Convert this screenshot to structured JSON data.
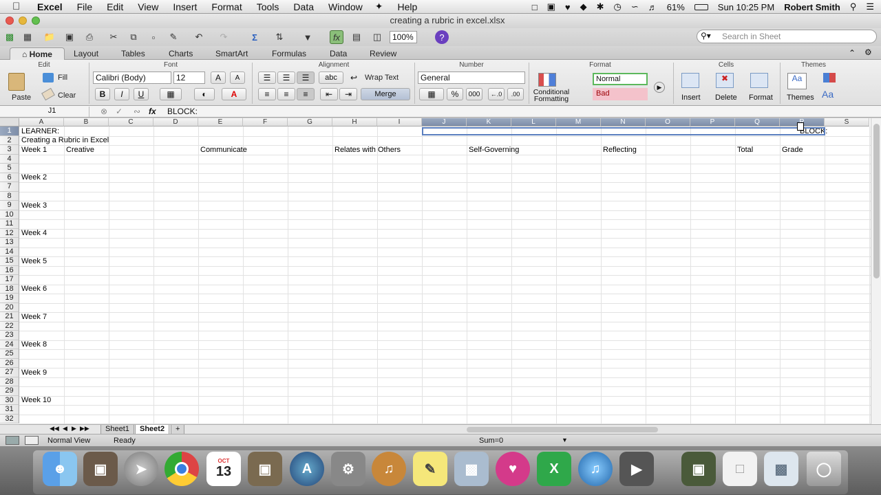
{
  "menubar": {
    "app": "Excel",
    "items": [
      "File",
      "Edit",
      "View",
      "Insert",
      "Format",
      "Tools",
      "Data",
      "Window",
      "Help"
    ],
    "battery": "61%",
    "clock": "Sun 10:25 PM",
    "user": "Robert Smith"
  },
  "window": {
    "title": "creating a rubric in excel.xlsx"
  },
  "toolbar": {
    "zoom": "100%",
    "search_placeholder": "Search in Sheet"
  },
  "ribbon": {
    "tabs": [
      "Home",
      "Layout",
      "Tables",
      "Charts",
      "SmartArt",
      "Formulas",
      "Data",
      "Review"
    ],
    "groups": {
      "edit": "Edit",
      "font": "Font",
      "alignment": "Alignment",
      "number": "Number",
      "format": "Format",
      "cells": "Cells",
      "themes": "Themes"
    },
    "paste": "Paste",
    "fill": "Fill",
    "clear": "Clear",
    "font_name": "Calibri (Body)",
    "font_size": "12",
    "wrap_text": "Wrap Text",
    "merge": "Merge",
    "number_format": "General",
    "conditional_formatting": "Conditional Formatting",
    "style_normal": "Normal",
    "style_bad": "Bad",
    "insert": "Insert",
    "delete": "Delete",
    "format": "Format",
    "themes": "Themes",
    "bold": "B",
    "italic": "I",
    "underline": "U",
    "percent": "%",
    "font_color_glyph": "A",
    "font_grow_glyph": "A",
    "font_shrink_glyph": "A",
    "abc_glyph": "abc",
    "decimal_inc_glyph": "←.0",
    "decimal_dec_glyph": ".00",
    "theme_font_glyph": "Aa"
  },
  "formula_bar": {
    "name_box": "J1",
    "fx": "fx",
    "content": "BLOCK:"
  },
  "columns": [
    "A",
    "B",
    "C",
    "D",
    "E",
    "F",
    "G",
    "H",
    "I",
    "J",
    "K",
    "L",
    "M",
    "N",
    "O",
    "P",
    "Q",
    "R",
    "S"
  ],
  "rows": [
    "1",
    "2",
    "3",
    "4",
    "5",
    "6",
    "7",
    "8",
    "9",
    "10",
    "11",
    "12",
    "13",
    "14",
    "15",
    "16",
    "17",
    "18",
    "19",
    "20",
    "21",
    "22",
    "23",
    "24",
    "25",
    "26",
    "27",
    "28",
    "29",
    "30",
    "31",
    "32"
  ],
  "cells": {
    "A1": "LEARNER:",
    "A2": "Creating a Rubric in Excel",
    "A3": "Week 1",
    "B3": "Creative",
    "E3": "Communicate",
    "H3": "Relates with Others",
    "K3": "Self-Governing",
    "N3": "Reflecting",
    "Q3": "Total",
    "R3": "Grade",
    "R1": "BLOCK:",
    "A6": "Week 2",
    "A9": "Week 3",
    "A12": "Week 4",
    "A15": "Week 5",
    "A18": "Week 6",
    "A21": "Week 7",
    "A24": "Week 8",
    "A27": "Week 9",
    "A30": "Week 10"
  },
  "sheets": {
    "tab1": "Sheet1",
    "tab2": "Sheet2",
    "add": "+"
  },
  "status": {
    "view": "Normal View",
    "ready": "Ready",
    "sum": "Sum=0"
  },
  "dock": {
    "calendar_month": "OCT",
    "calendar_day": "13"
  }
}
